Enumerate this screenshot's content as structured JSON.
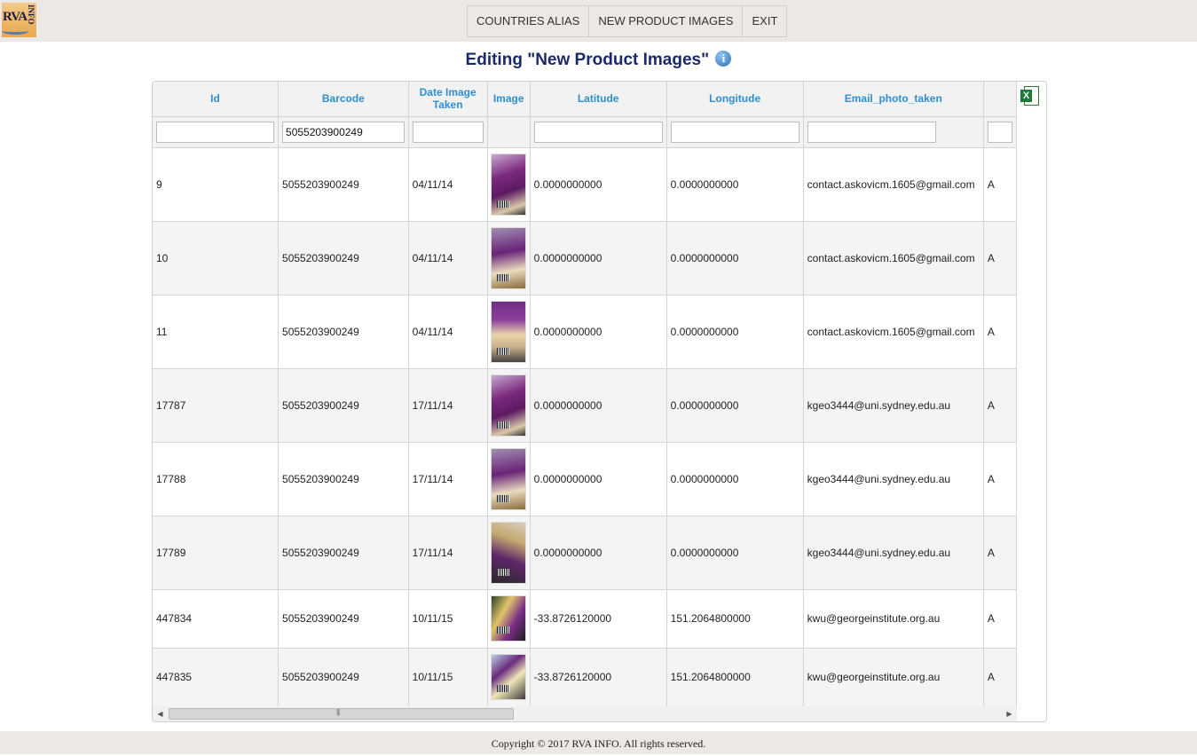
{
  "logo": {
    "text": "RVA",
    "subtext": "INFO"
  },
  "menu": {
    "items": [
      "COUNTRIES ALIAS",
      "NEW PRODUCT IMAGES",
      "EXIT"
    ]
  },
  "page_title": "Editing \"New Product Images\"",
  "grid": {
    "columns": [
      "Id",
      "Barcode",
      "Date Image Taken",
      "Image",
      "Latitude",
      "Longitude",
      "Email_photo_taken"
    ],
    "filters": {
      "id": "",
      "barcode": "5055203900249",
      "date": "",
      "latitude": "",
      "longitude": "",
      "email": ""
    },
    "rows": [
      {
        "id": "9",
        "barcode": "5055203900249",
        "date": "04/11/14",
        "latitude": "0.0000000000",
        "longitude": "0.0000000000",
        "email": "contact.askovicm.1605@gmail.com",
        "extra": "A"
      },
      {
        "id": "10",
        "barcode": "5055203900249",
        "date": "04/11/14",
        "latitude": "0.0000000000",
        "longitude": "0.0000000000",
        "email": "contact.askovicm.1605@gmail.com",
        "extra": "A"
      },
      {
        "id": "11",
        "barcode": "5055203900249",
        "date": "04/11/14",
        "latitude": "0.0000000000",
        "longitude": "0.0000000000",
        "email": "contact.askovicm.1605@gmail.com",
        "extra": "A"
      },
      {
        "id": "17787",
        "barcode": "5055203900249",
        "date": "17/11/14",
        "latitude": "0.0000000000",
        "longitude": "0.0000000000",
        "email": "kgeo3444@uni.sydney.edu.au",
        "extra": "A"
      },
      {
        "id": "17788",
        "barcode": "5055203900249",
        "date": "17/11/14",
        "latitude": "0.0000000000",
        "longitude": "0.0000000000",
        "email": "kgeo3444@uni.sydney.edu.au",
        "extra": "A"
      },
      {
        "id": "17789",
        "barcode": "5055203900249",
        "date": "17/11/14",
        "latitude": "0.0000000000",
        "longitude": "0.0000000000",
        "email": "kgeo3444@uni.sydney.edu.au",
        "extra": "A"
      },
      {
        "id": "447834",
        "barcode": "5055203900249",
        "date": "10/11/15",
        "latitude": "-33.8726120000",
        "longitude": "151.2064800000",
        "email": "kwu@georgeinstitute.org.au",
        "extra": "A"
      },
      {
        "id": "447835",
        "barcode": "5055203900249",
        "date": "10/11/15",
        "latitude": "-33.8726120000",
        "longitude": "151.2064800000",
        "email": "kwu@georgeinstitute.org.au",
        "extra": "A"
      }
    ]
  },
  "footer": {
    "copyright": "Copyright © 2017 RVA INFO. All rights reserved."
  }
}
